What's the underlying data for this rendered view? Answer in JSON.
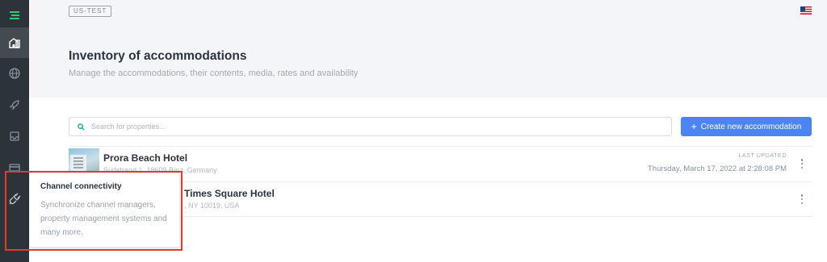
{
  "sidebar": {
    "items": [
      {
        "icon": "menu-logo-icon",
        "active": false
      },
      {
        "icon": "accommodations-icon",
        "active": true
      },
      {
        "icon": "globe-icon",
        "active": false
      },
      {
        "icon": "rocket-icon",
        "active": false
      },
      {
        "icon": "inbox-icon",
        "active": false
      },
      {
        "icon": "card-icon",
        "active": false
      },
      {
        "icon": "plug-icon",
        "active": false
      }
    ]
  },
  "header": {
    "env_badge": "US-TEST",
    "title": "Inventory of accommodations",
    "subtitle": "Manage the accommodations, their contents, media, rates and availability",
    "flag": "us-flag-icon"
  },
  "search": {
    "placeholder": "Search for properties...",
    "value": ""
  },
  "actions": {
    "create_label": "Create new accommodation",
    "create_icon": "+"
  },
  "hotels": [
    {
      "name": "Prora Beach Hotel",
      "address": "Südstrand 1, 18609 Binz, Germany",
      "updated_label": "LAST UPDATED",
      "updated_value": "Thursday, March 17, 2022 at 2:28:08 PM"
    },
    {
      "name": "Times Square Hotel",
      "address": ", NY 10019, USA",
      "updated_label": "",
      "updated_value": ""
    }
  ],
  "tooltip": {
    "title": "Channel connectivity",
    "body": "Synchronize channel managers, property management systems and many more."
  },
  "colors": {
    "sidebar_bg": "#2d3439",
    "accent": "#2ecc71",
    "primary_button": "#4d84f3",
    "highlight": "#e23b30"
  }
}
